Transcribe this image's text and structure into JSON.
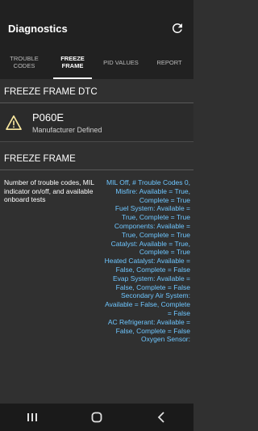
{
  "app": {
    "title": "Diagnostics"
  },
  "tabs": [
    {
      "label": "TROUBLE CODES",
      "line1": "TROUBLE",
      "line2": "CODES",
      "active": false
    },
    {
      "label": "FREEZE FRAME",
      "line1": "FREEZE",
      "line2": "FRAME",
      "active": true
    },
    {
      "label": "PID VALUES",
      "line1": "PID VALUES",
      "line2": "",
      "active": false
    },
    {
      "label": "REPORT",
      "line1": "REPORT",
      "line2": "",
      "active": false
    }
  ],
  "dtc_section": {
    "title": "FREEZE FRAME DTC",
    "item": {
      "code": "P060E",
      "description": "Manufacturer Defined",
      "icon": "warning-icon"
    }
  },
  "freeze_frame": {
    "title": "FREEZE FRAME",
    "rows": [
      {
        "label": "Number of trouble codes, MIL indicator on/off, and available onboard tests",
        "value": "MIL Off, # Trouble Codes 0, Misfire: Available = True, Complete = True\nFuel System: Available = True, Complete = True\nComponents: Available = True, Complete = True\nCatalyst: Available = True, Complete = True\nHeated Catalyst: Available = False, Complete = False\nEvap System: Available = False, Complete = False\nSecondary Air System: Available = False, Complete = False\nAC Refrigerant: Available = False, Complete = False\nOxygen Sensor:"
      }
    ]
  },
  "colors": {
    "background": "#303030",
    "appbar": "#212121",
    "value_text": "#6ec6ff",
    "warning": "#f9e79f"
  },
  "navbar": {
    "icons": [
      "recents-icon",
      "home-icon",
      "back-icon"
    ]
  }
}
